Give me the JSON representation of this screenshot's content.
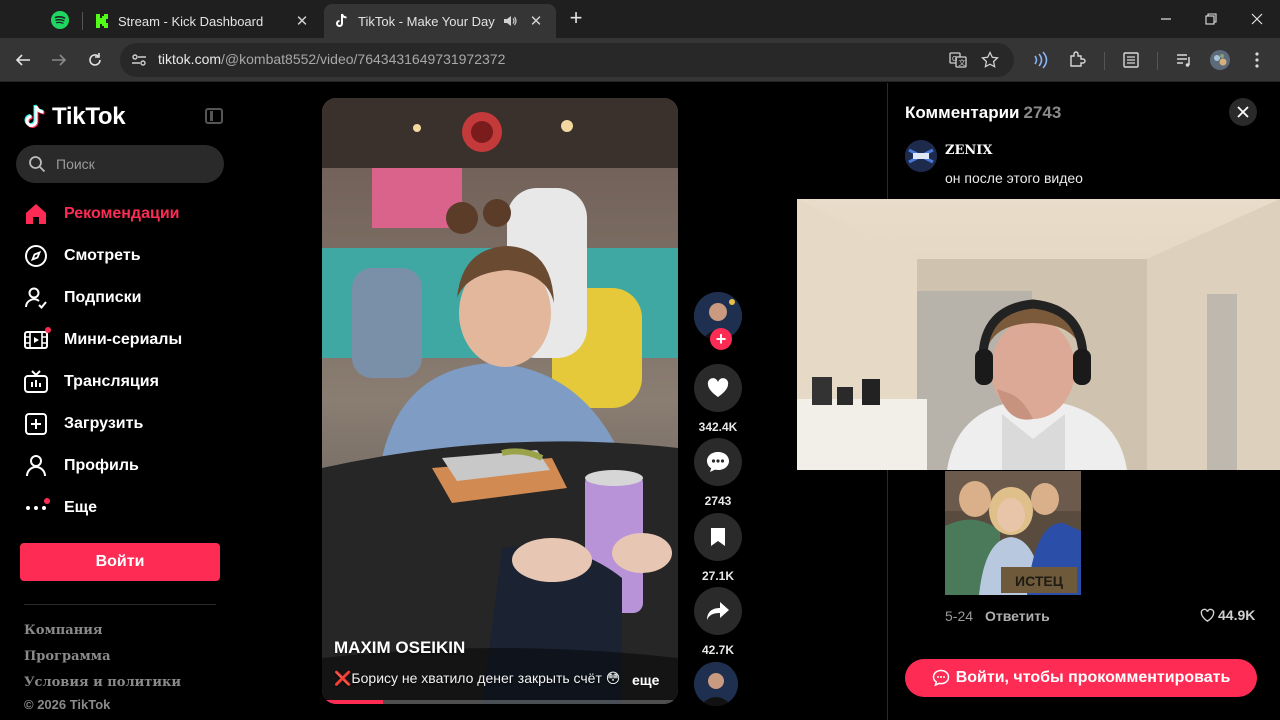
{
  "browser": {
    "tabs": [
      {
        "title": "",
        "icon": "spotify-icon",
        "pinned": true
      },
      {
        "title": "Stream - Kick Dashboard",
        "icon": "kick-icon"
      },
      {
        "title": "TikTok - Make Your Day",
        "icon": "tiktok-icon",
        "active": true,
        "audio": true
      }
    ],
    "url_domain": "tiktok.com",
    "url_path": "/@kombat8552/video/7643431649731972372"
  },
  "sidebar": {
    "logo_text": "TikTok",
    "search_placeholder": "Поиск",
    "menu": [
      {
        "label": "Рекомендации",
        "icon": "home-icon",
        "active": true
      },
      {
        "label": "Смотреть",
        "icon": "compass-icon"
      },
      {
        "label": "Подписки",
        "icon": "following-icon"
      },
      {
        "label": "Мини-сериалы",
        "icon": "film-icon",
        "badge": true
      },
      {
        "label": "Трансляция",
        "icon": "live-tv-icon"
      },
      {
        "label": "Загрузить",
        "icon": "upload-icon"
      },
      {
        "label": "Профиль",
        "icon": "profile-icon"
      },
      {
        "label": "Еще",
        "icon": "more-icon",
        "badge": true
      }
    ],
    "login_label": "Войти",
    "footer": [
      "Компания",
      "Программа",
      "Условия и политики"
    ],
    "copyright": "© 2026 TikTok"
  },
  "video": {
    "author": "MAXIM OSEIKIN",
    "caption": "❌Борису не хватило денег закрыть счёт 😳",
    "more_label": "еще",
    "progress": 0.17
  },
  "actions": {
    "likes": "342.4K",
    "comments": "2743",
    "saves": "27.1K",
    "shares": "42.7K"
  },
  "comments_panel": {
    "title": "Комментарии",
    "count": "2743",
    "first_comment": {
      "user": "ZENIX",
      "text": "он после этого видео",
      "date": "5-24",
      "reply_label": "Ответить",
      "likes": "44.9K",
      "image_sign_text": "ИСТЕЦ"
    },
    "login_label": "Войти, чтобы прокомментировать"
  },
  "colors": {
    "brand": "#fe2c55",
    "background": "#000000",
    "chrome_tabbar": "#1f1f1f",
    "chrome_toolbar": "#353535"
  }
}
